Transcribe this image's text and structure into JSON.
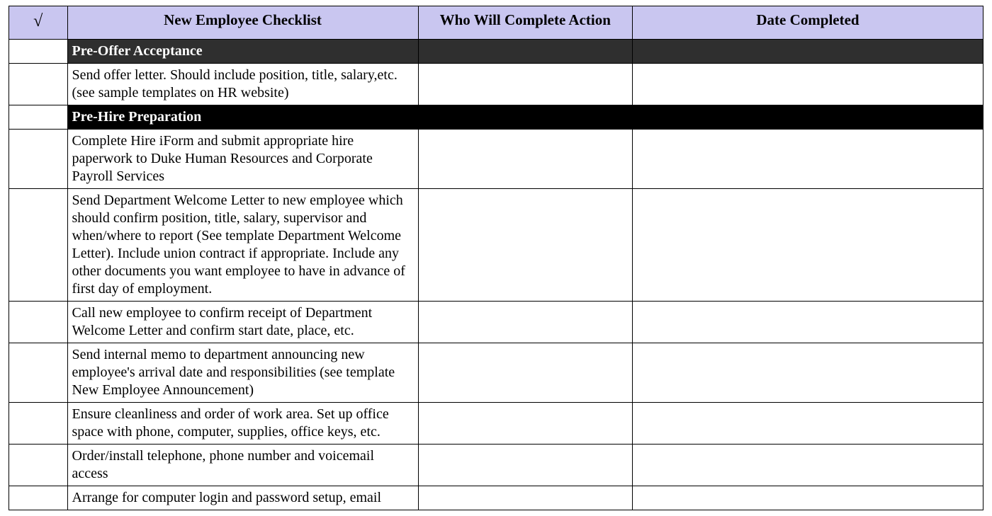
{
  "headers": {
    "checkmark": "√",
    "checklist": "New Employee Checklist",
    "who": "Who Will Complete Action",
    "date": "Date Completed"
  },
  "sections": [
    {
      "title": "Pre-Offer Acceptance",
      "style": "dark",
      "items": [
        {
          "desc": "Send offer letter. Should include position, title, salary,etc. (see sample templates on HR website)",
          "who": "",
          "date": ""
        }
      ]
    },
    {
      "title": "Pre-Hire Preparation",
      "style": "black",
      "items": [
        {
          "desc": "Complete Hire iForm and submit appropriate hire paperwork to Duke Human Resources and Corporate Payroll Services",
          "who": "",
          "date": ""
        },
        {
          "desc": "Send Department Welcome Letter to new employee which should confirm position, title, salary, supervisor and when/where to report (See template Department Welcome Letter). Include union contract if appropriate. Include any other documents you want employee to have in advance of first day of employment.",
          "who": "",
          "date": ""
        },
        {
          "desc": "Call new employee to confirm receipt of Department Welcome Letter and confirm start date, place, etc.",
          "who": "",
          "date": ""
        },
        {
          "desc": "Send internal memo to department announcing new employee's arrival date and responsibilities (see template New Employee Announcement)",
          "who": "",
          "date": ""
        },
        {
          "desc": "Ensure cleanliness and order of work area. Set up office space with phone, computer, supplies, office keys, etc.",
          "who": "",
          "date": ""
        },
        {
          "desc": "Order/install telephone, phone number and voicemail access",
          "who": "",
          "date": ""
        },
        {
          "desc": "Arrange for computer login and password setup, email",
          "who": "",
          "date": ""
        }
      ]
    }
  ]
}
